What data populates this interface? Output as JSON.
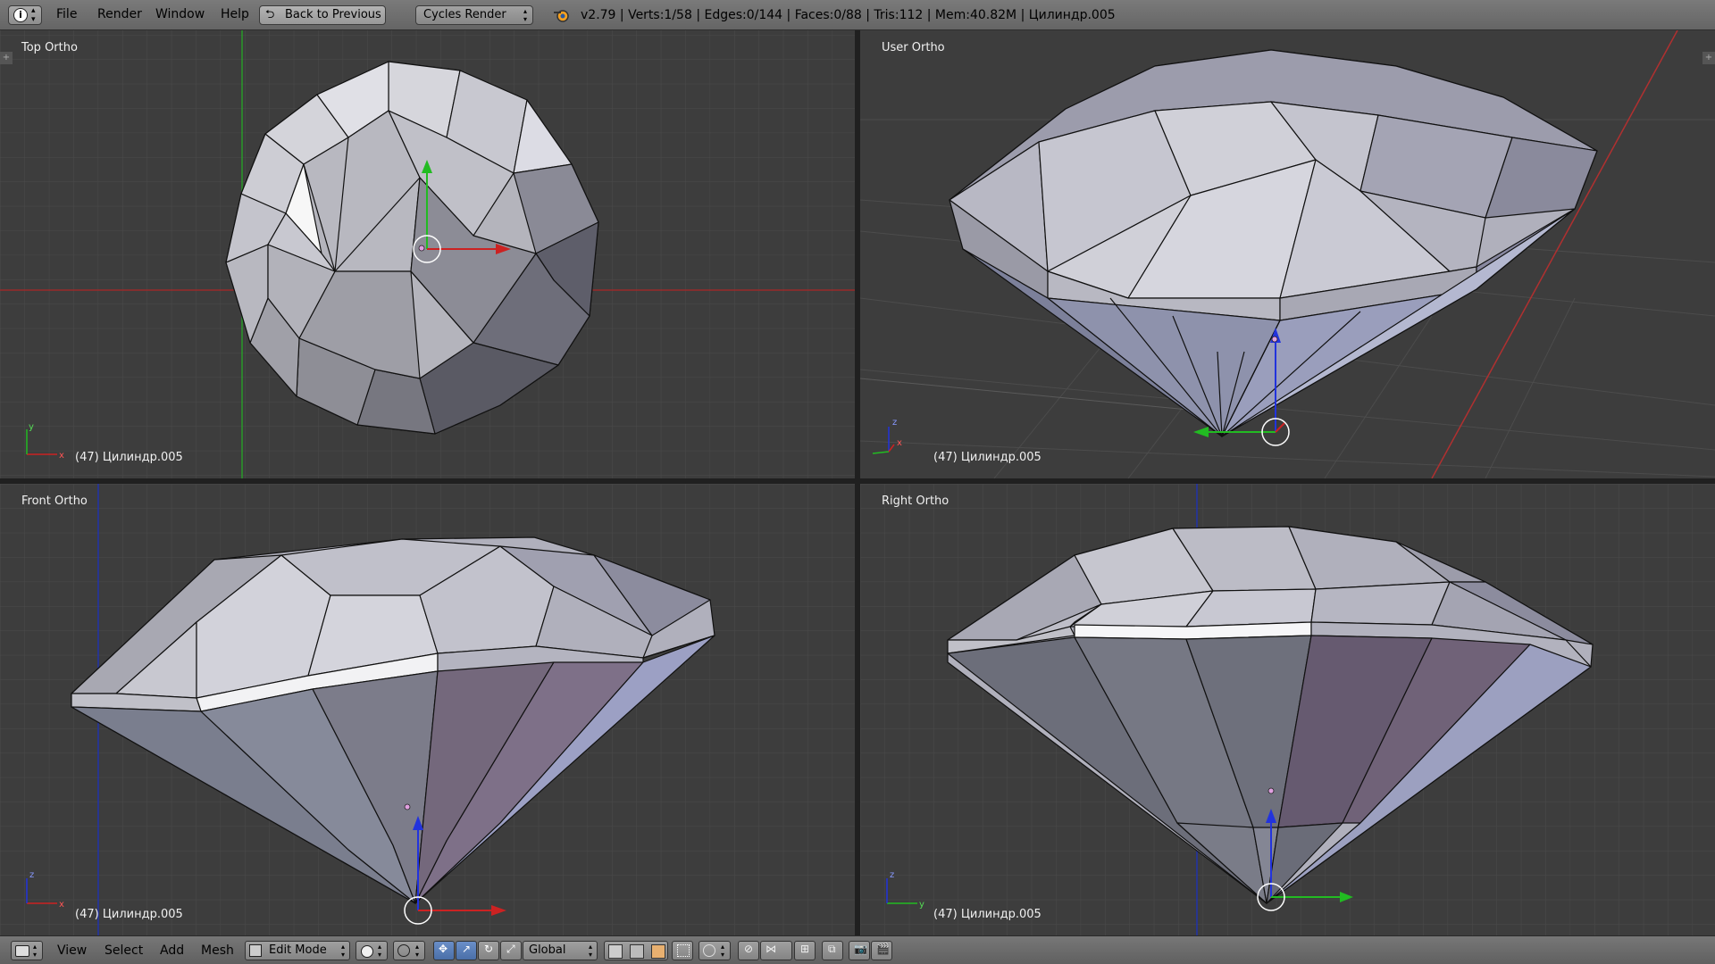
{
  "topbar": {
    "menus": [
      "File",
      "Render",
      "Window",
      "Help"
    ],
    "back_button": "Back to Previous",
    "render_engine": "Cycles Render",
    "stats": "v2.79 | Verts:1/58 | Edges:0/144 | Faces:0/88 | Tris:112 | Mem:40.82M | Цилиндр.005"
  },
  "viewports": [
    {
      "label": "Top Ortho",
      "object": "(47) Цилиндр.005"
    },
    {
      "label": "User Ortho",
      "object": "(47) Цилиндр.005"
    },
    {
      "label": "Front Ortho",
      "object": "(47) Цилиндр.005"
    },
    {
      "label": "Right Ortho",
      "object": "(47) Цилиндр.005"
    }
  ],
  "axis_labels": {
    "x": "x",
    "y": "y",
    "z": "z"
  },
  "bottombar": {
    "menus": [
      "View",
      "Select",
      "Add",
      "Mesh"
    ],
    "mode": "Edit Mode",
    "orientation": "Global"
  },
  "icons": [
    "info-icon",
    "blender-logo-icon",
    "back-arrow-icon",
    "editor-type-icon",
    "shading-sphere-icon",
    "pivot-icon",
    "manipulator-translate-icon",
    "manipulator-rotate-icon",
    "manipulator-scale-icon",
    "vertex-select-icon",
    "edge-select-icon",
    "face-select-icon",
    "limit-visible-icon",
    "proportional-edit-icon",
    "snap-icon",
    "render-still-icon",
    "render-anim-icon"
  ],
  "colors": {
    "x_axis": "#cc2222",
    "y_axis": "#22bb22",
    "z_axis": "#2233dd",
    "grid_bg": "#3d3d3d",
    "mesh_light": "#d4d4dc",
    "mesh_dark": "#6a6a78"
  }
}
